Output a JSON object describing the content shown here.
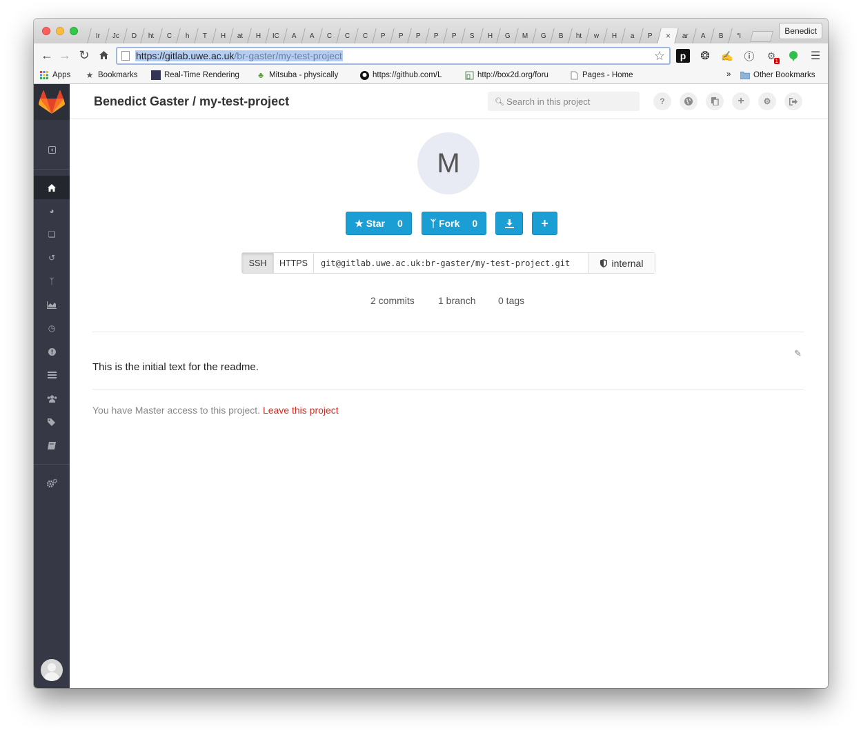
{
  "browser": {
    "tabs": [
      "Ir",
      "Jc",
      "D",
      "ht",
      "C",
      "h",
      "T",
      "H",
      "at",
      "H",
      "IC",
      "A",
      "A",
      "C",
      "C",
      "C",
      "P",
      "P",
      "P",
      "P",
      "P",
      "S",
      "H",
      "G",
      "M",
      "G",
      "B",
      "ht",
      "w",
      "H",
      "a",
      "P",
      "×",
      "ar",
      "A",
      "B",
      "“I"
    ],
    "active_tab_index": 32,
    "profile_button": "Benedict",
    "url_host": "https://gitlab.uwe.ac.uk",
    "url_path": "/br-gaster/my-test-project",
    "extension_badge": "1",
    "bookmarks": {
      "apps": "Apps",
      "bookmarks": "Bookmarks",
      "realtime": "Real-Time Rendering",
      "mitsuba": "Mitsuba - physically",
      "github": "https://github.com/L",
      "box2d": "http://box2d.org/foru",
      "pages": "Pages - Home",
      "overflow": "»",
      "other": "Other Bookmarks"
    }
  },
  "header": {
    "title": "Benedict Gaster / my-test-project",
    "search_placeholder": "Search in this project"
  },
  "project": {
    "avatar_letter": "M",
    "star_label": "Star",
    "star_count": "0",
    "fork_label": "Fork",
    "fork_count": "0",
    "clone": {
      "ssh_label": "SSH",
      "https_label": "HTTPS",
      "url": "git@gitlab.uwe.ac.uk:br-gaster/my-test-project.git",
      "visibility": "internal"
    },
    "stats": {
      "commits": "2 commits",
      "branches": "1 branch",
      "tags": "0 tags"
    },
    "readme_text": "This is the initial text for the readme.",
    "access_text": "You have Master access to this project.",
    "leave_link": "Leave this project"
  },
  "colors": {
    "sidebar": "#363945",
    "primary_button": "#1b9ed3",
    "leave_link": "#d62b21"
  }
}
